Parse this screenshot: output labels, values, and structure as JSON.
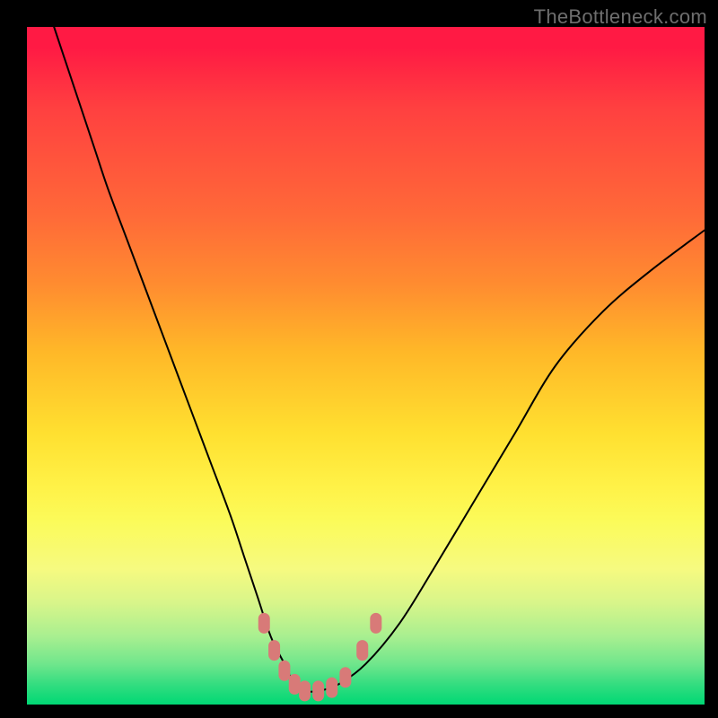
{
  "watermark": "TheBottleneck.com",
  "chart_data": {
    "type": "line",
    "title": "",
    "xlabel": "",
    "ylabel": "",
    "xlim": [
      0,
      100
    ],
    "ylim": [
      0,
      100
    ],
    "grid": false,
    "legend": false,
    "background": "rainbow-vertical-gradient",
    "series": [
      {
        "name": "bottleneck-curve",
        "x": [
          4,
          6,
          8,
          10,
          12,
          15,
          18,
          21,
          24,
          27,
          30,
          32,
          34,
          36,
          38,
          39.5,
          41,
          43,
          46,
          50,
          55,
          60,
          66,
          72,
          78,
          85,
          92,
          100
        ],
        "values": [
          100,
          94,
          88,
          82,
          76,
          68,
          60,
          52,
          44,
          36,
          28,
          22,
          16,
          10,
          6,
          3,
          2,
          2,
          3,
          6,
          12,
          20,
          30,
          40,
          50,
          58,
          64,
          70
        ]
      }
    ],
    "markers": [
      {
        "x": 35.0,
        "y": 12
      },
      {
        "x": 36.5,
        "y": 8
      },
      {
        "x": 38.0,
        "y": 5
      },
      {
        "x": 39.5,
        "y": 3
      },
      {
        "x": 41.0,
        "y": 2
      },
      {
        "x": 43.0,
        "y": 2
      },
      {
        "x": 45.0,
        "y": 2.5
      },
      {
        "x": 47.0,
        "y": 4
      },
      {
        "x": 49.5,
        "y": 8
      },
      {
        "x": 51.5,
        "y": 12
      }
    ],
    "colors": {
      "top": "#ff1a44",
      "mid": "#ffe030",
      "bottom": "#00d874",
      "marker": "#d87a78",
      "line": "#000000"
    }
  }
}
